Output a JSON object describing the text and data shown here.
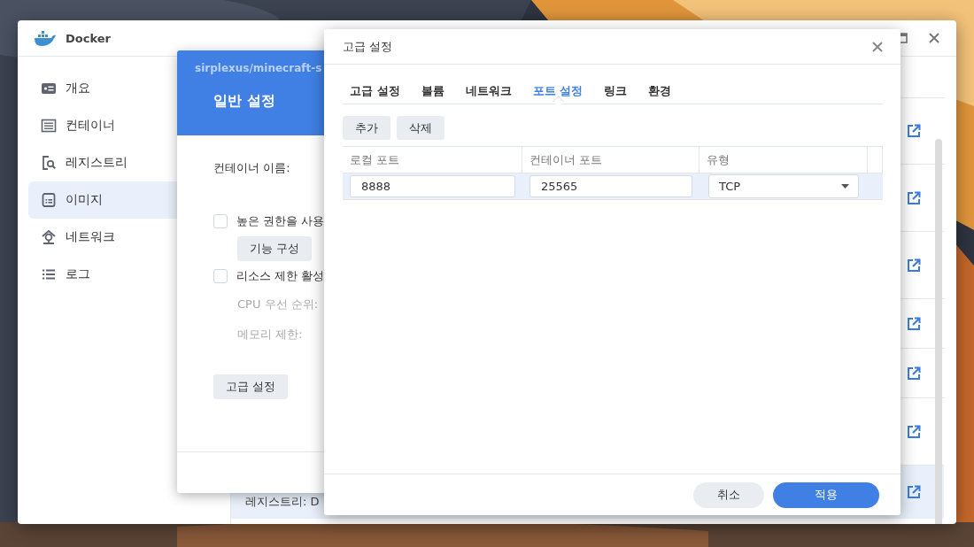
{
  "window": {
    "title": "Docker"
  },
  "sidebar": {
    "items": [
      {
        "label": "개요",
        "selected": false
      },
      {
        "label": "컨테이너",
        "selected": false
      },
      {
        "label": "레지스트리",
        "selected": false
      },
      {
        "label": "이미지",
        "selected": true
      },
      {
        "label": "네트워크",
        "selected": false
      },
      {
        "label": "로그",
        "selected": false
      }
    ]
  },
  "image_list": {
    "rows": [
      {
        "selected": false
      },
      {
        "selected": false
      },
      {
        "selected": false
      },
      {
        "selected": false
      },
      {
        "selected": false
      },
      {
        "selected": false
      },
      {
        "selected": true,
        "text": "레지스트리: D"
      }
    ]
  },
  "general_dialog": {
    "image": "sirplexus/minecraft-s",
    "title": "일반 설정",
    "name_label": "컨테이너 이름:",
    "options": [
      {
        "kind": "checkbox",
        "label": "높은 권한을 사용",
        "checked": false
      },
      {
        "kind": "button",
        "label": "기능 구성"
      },
      {
        "kind": "checkbox",
        "label": "리소스 제한 활성",
        "checked": false
      },
      {
        "kind": "field",
        "label": "CPU 우선 순위:",
        "disabled": true
      },
      {
        "kind": "field",
        "label": "메모리 제한:",
        "disabled": true
      }
    ],
    "advanced_button": "고급 설정"
  },
  "advanced_dialog": {
    "title": "고급 설정",
    "tabs": [
      {
        "label": "고급 설정",
        "selected": false
      },
      {
        "label": "볼륨",
        "selected": false
      },
      {
        "label": "네트워크",
        "selected": false
      },
      {
        "label": "포트 설정",
        "selected": true
      },
      {
        "label": "링크",
        "selected": false
      },
      {
        "label": "환경",
        "selected": false
      }
    ],
    "toolbar": [
      "추가",
      "삭제"
    ],
    "table": {
      "columns": [
        "로컬 포트",
        "컨테이너 포트",
        "유형"
      ],
      "rows": [
        {
          "local_port": "8888",
          "container_port": "25565",
          "type": "TCP",
          "selected": true
        }
      ]
    },
    "buttons": [
      {
        "label": "취소",
        "kind": "secondary"
      },
      {
        "label": "적용",
        "kind": "primary"
      }
    ]
  }
}
